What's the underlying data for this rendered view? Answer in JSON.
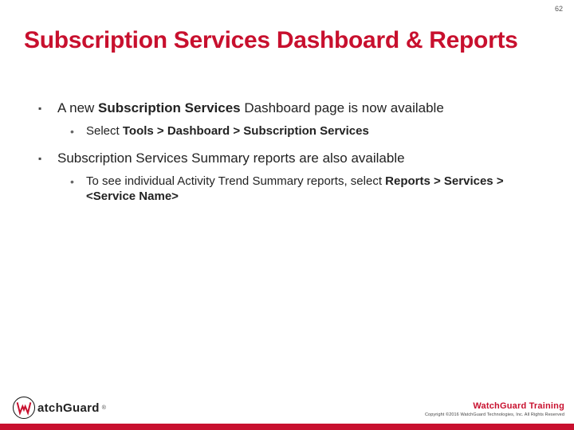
{
  "page_number": "62",
  "title": "Subscription Services Dashboard & Reports",
  "bullets": [
    {
      "before": "A new ",
      "bold": "Subscription Services",
      "after": " Dashboard page is now available",
      "sub": [
        {
          "before": "Select ",
          "bold": "Tools > Dashboard > Subscription Services",
          "after": ""
        }
      ]
    },
    {
      "before": "Subscription Services Summary reports are also available",
      "bold": "",
      "after": "",
      "sub": [
        {
          "before": "To see individual Activity Trend Summary reports, select ",
          "bold": "Reports > Services > <Service Name>",
          "after": ""
        }
      ]
    }
  ],
  "footer": {
    "logo_rest": "atchGuard",
    "training": "WatchGuard Training",
    "copyright": "Copyright ©2016 WatchGuard Technologies, Inc. All Rights Reserved"
  }
}
